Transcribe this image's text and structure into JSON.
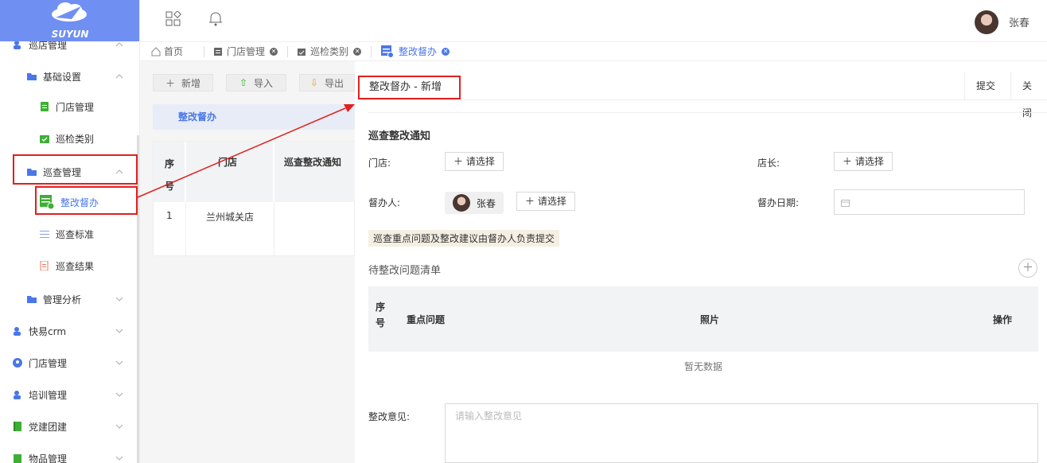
{
  "brand": {
    "name": "SUYUN"
  },
  "header": {
    "user_name": "张春"
  },
  "tabs": [
    {
      "label": "首页"
    },
    {
      "label": "门店管理"
    },
    {
      "label": "巡检类别"
    },
    {
      "label": "整改督办"
    }
  ],
  "sidebar": {
    "items": [
      {
        "label": "巡店管理"
      },
      {
        "label": "基础设置"
      },
      {
        "label": "门店管理"
      },
      {
        "label": "巡检类别"
      },
      {
        "label": "巡查管理"
      },
      {
        "label": "整改督办"
      },
      {
        "label": "巡查标准"
      },
      {
        "label": "巡查结果"
      },
      {
        "label": "管理分析"
      },
      {
        "label": "快易crm"
      },
      {
        "label": "门店管理"
      },
      {
        "label": "培训管理"
      },
      {
        "label": "党建团建"
      },
      {
        "label": "物品管理"
      }
    ]
  },
  "list": {
    "toolbar": {
      "add": "新增",
      "import": "导入",
      "export": "导出"
    },
    "tree_title": "整改督办",
    "columns": [
      "序号",
      "门店",
      "巡查整改通知"
    ],
    "rows": [
      {
        "index": "1",
        "store": "兰州城关店",
        "notice": ""
      }
    ]
  },
  "form": {
    "title": "整改督办 - 新增",
    "submit": "提交",
    "close": "关闭",
    "section_title": "巡查整改通知",
    "store_label": "门店:",
    "select_label": "请选择",
    "manager_label": "店长:",
    "supervisor_label": "督办人:",
    "supervisor_name": "张春",
    "date_label": "督办日期:",
    "tip": "巡查重点问题及整改建议由督办人负责提交",
    "issues_title": "待整改问题清单",
    "issue_columns": {
      "index": "序号",
      "issue": "重点问题",
      "photo": "照片",
      "action": "操作"
    },
    "empty_text": "暂无数据",
    "opinion_label": "整改意见:",
    "opinion_placeholder": "请输入整改意见"
  }
}
